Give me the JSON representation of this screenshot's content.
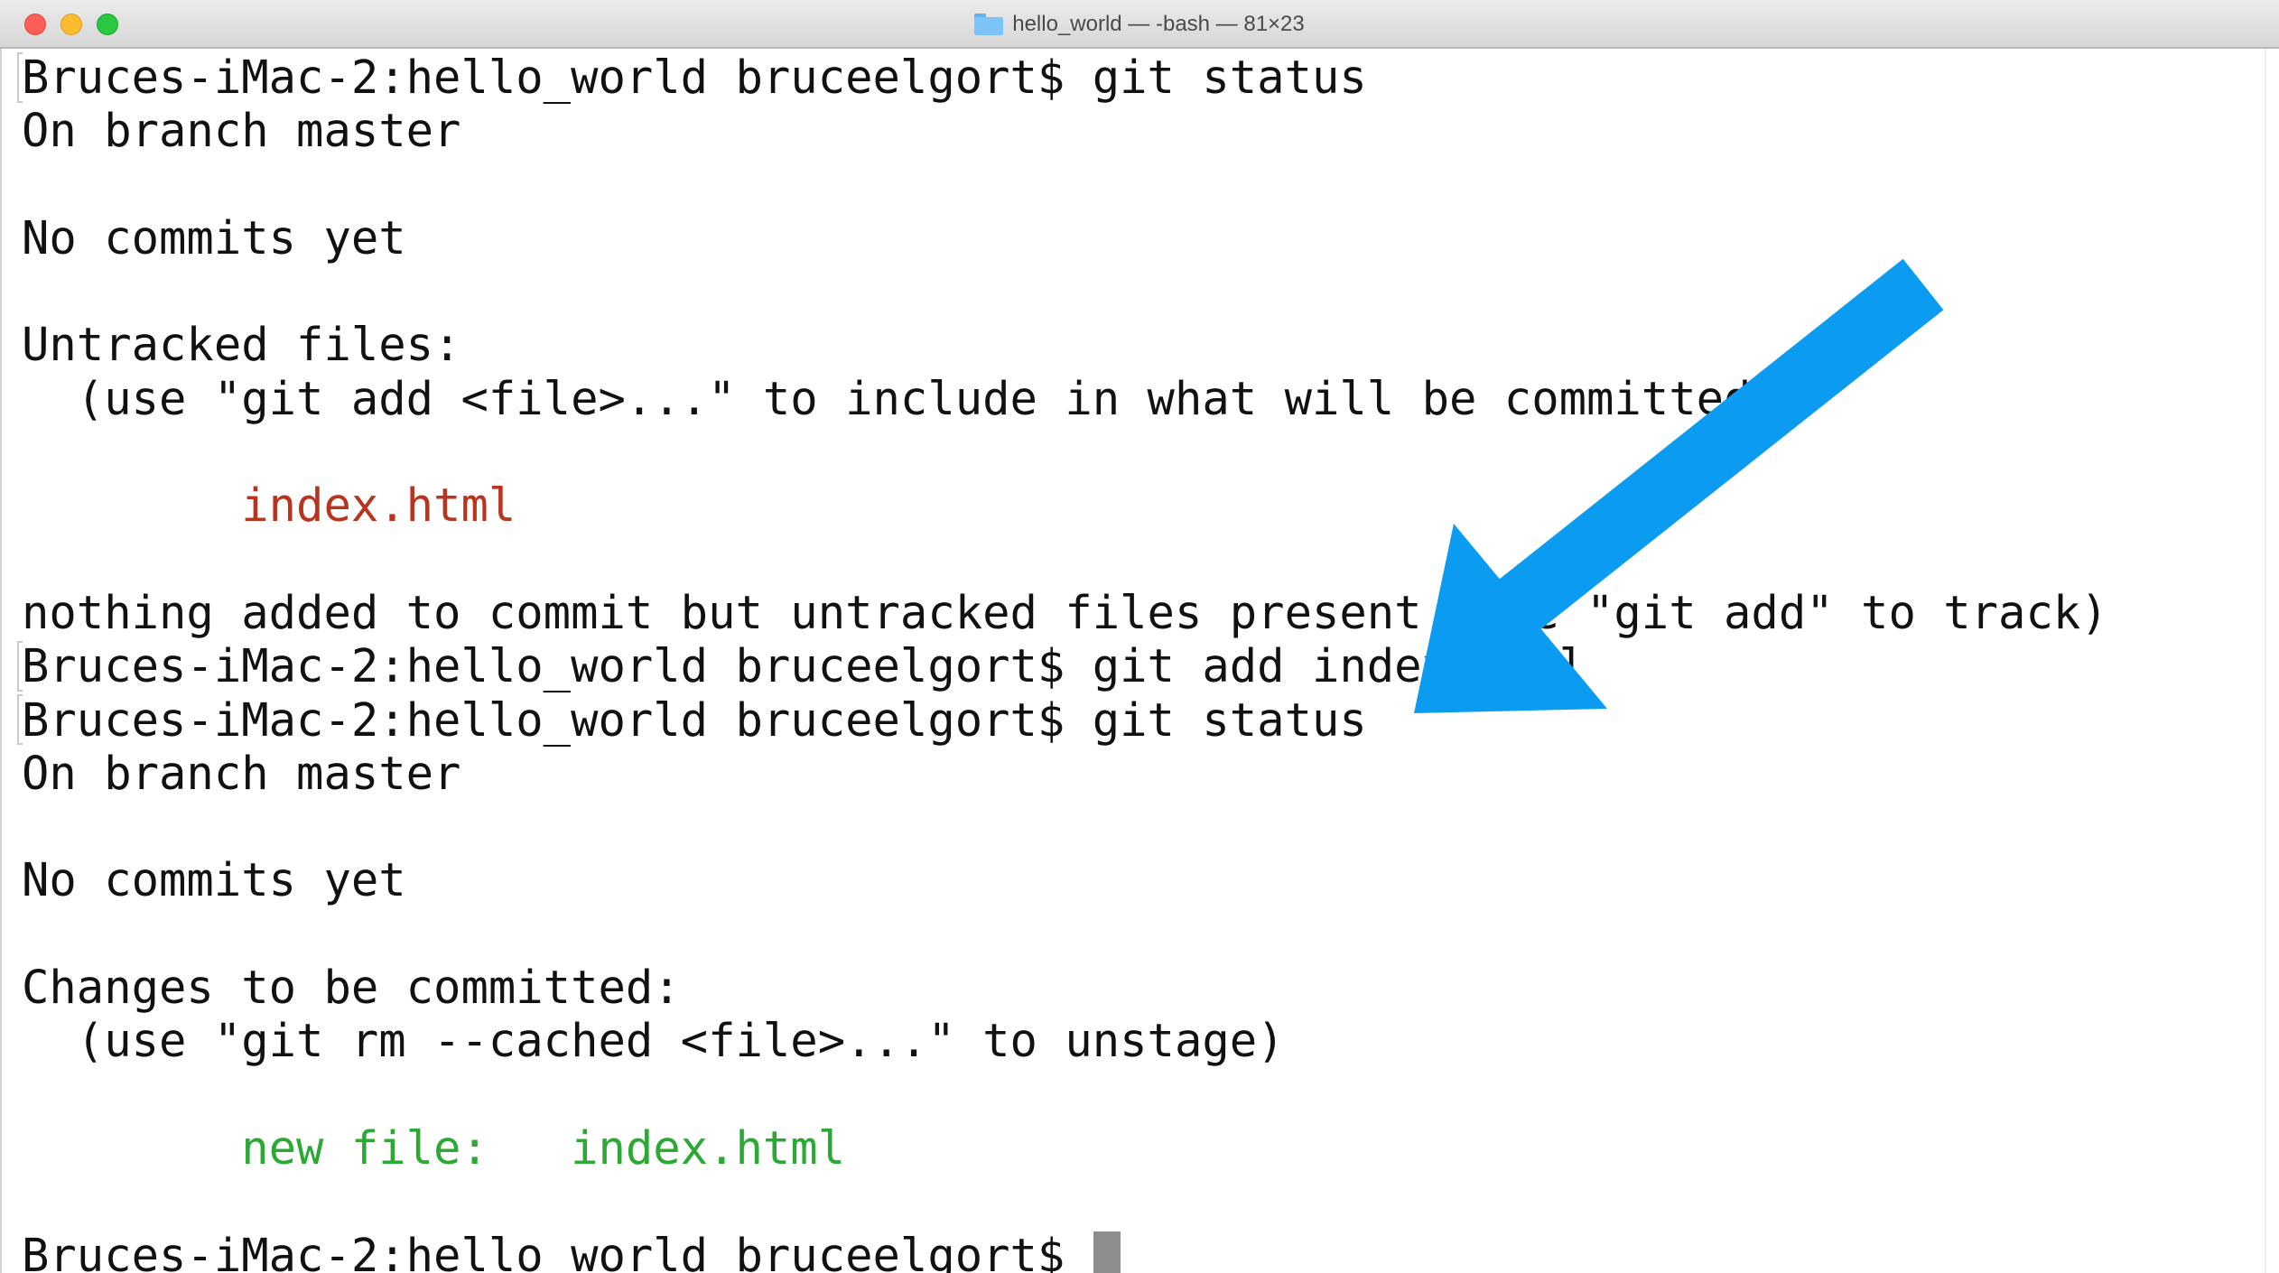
{
  "window": {
    "title": "hello_world — -bash — 81×23",
    "folder_icon": "folder-icon"
  },
  "terminal": {
    "lines": [
      {
        "type": "text",
        "text": "Bruces-iMac-2:hello_world bruceelgort$ git status"
      },
      {
        "type": "text",
        "text": "On branch master"
      },
      {
        "type": "text",
        "text": ""
      },
      {
        "type": "text",
        "text": "No commits yet"
      },
      {
        "type": "text",
        "text": ""
      },
      {
        "type": "text",
        "text": "Untracked files:"
      },
      {
        "type": "text",
        "text": "  (use \"git add <file>...\" to include in what will be committed)"
      },
      {
        "type": "text",
        "text": ""
      },
      {
        "type": "red",
        "text": "        index.html"
      },
      {
        "type": "text",
        "text": ""
      },
      {
        "type": "text",
        "text": "nothing added to commit but untracked files present (use \"git add\" to track)"
      },
      {
        "type": "text",
        "text": "Bruces-iMac-2:hello_world bruceelgort$ git add index.html"
      },
      {
        "type": "text",
        "text": "Bruces-iMac-2:hello_world bruceelgort$ git status"
      },
      {
        "type": "text",
        "text": "On branch master"
      },
      {
        "type": "text",
        "text": ""
      },
      {
        "type": "text",
        "text": "No commits yet"
      },
      {
        "type": "text",
        "text": ""
      },
      {
        "type": "text",
        "text": "Changes to be committed:"
      },
      {
        "type": "text",
        "text": "  (use \"git rm --cached <file>...\" to unstage)"
      },
      {
        "type": "text",
        "text": ""
      },
      {
        "type": "green",
        "text": "        new file:   index.html"
      },
      {
        "type": "text",
        "text": ""
      },
      {
        "type": "prompt",
        "text": "Bruces-iMac-2:hello_world bruceelgort$"
      }
    ]
  },
  "annotation": {
    "arrow_color": "#0b9cf1",
    "icon": "arrow-down-left-icon"
  },
  "colors": {
    "untracked": "#b8341f",
    "staged": "#2ca935",
    "text": "#111111"
  }
}
